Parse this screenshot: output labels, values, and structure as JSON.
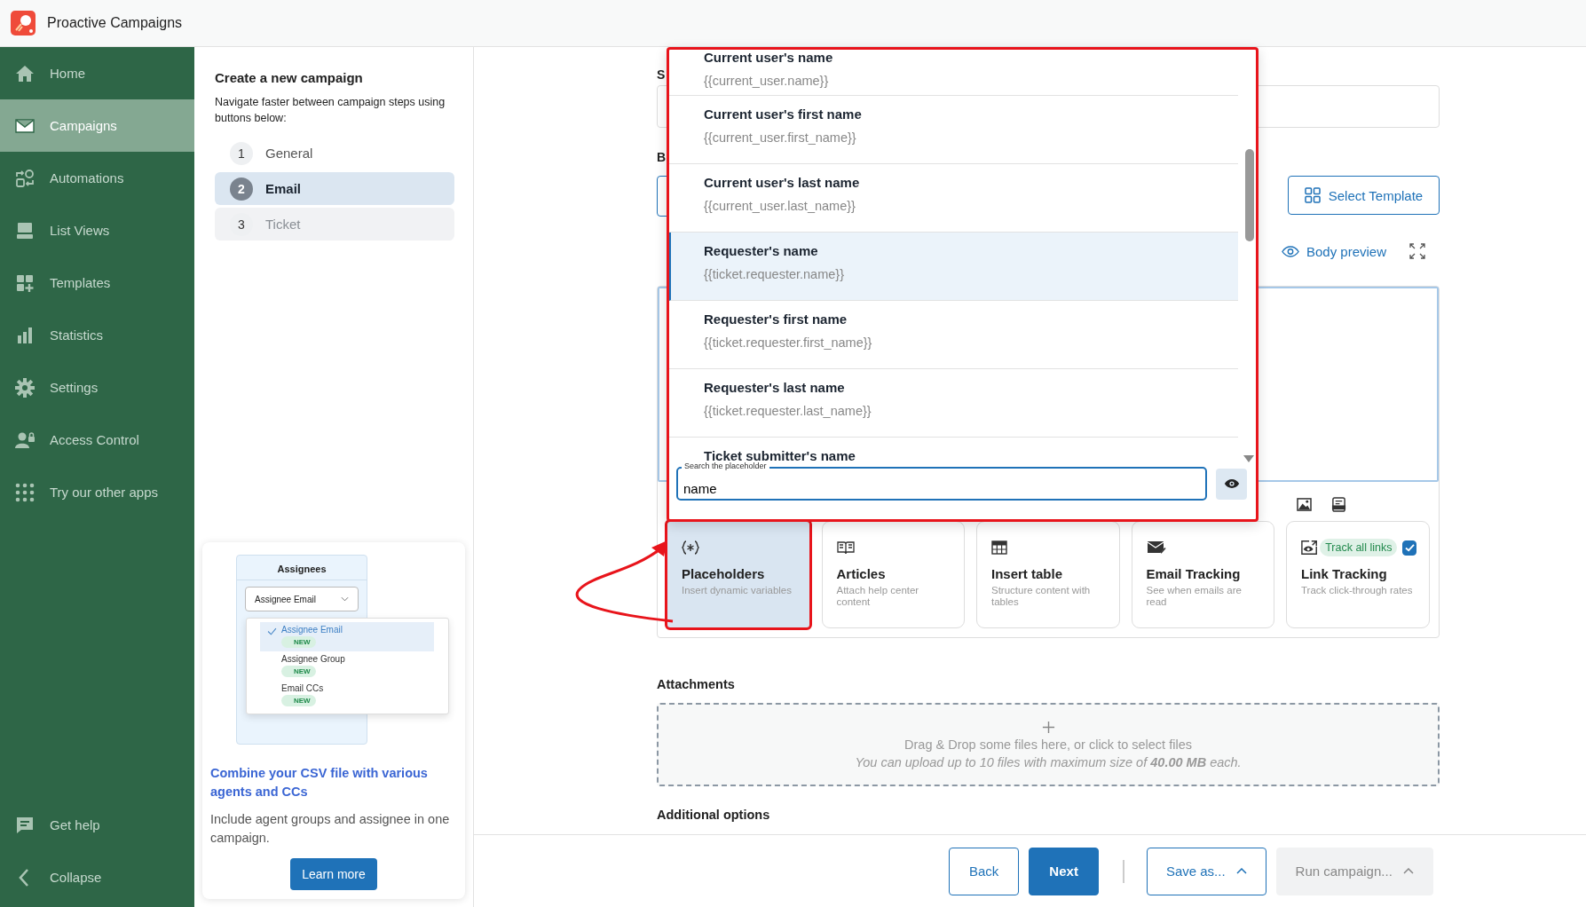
{
  "app": {
    "title": "Proactive Campaigns"
  },
  "sidebar": {
    "items": [
      {
        "label": "Home",
        "selected": false
      },
      {
        "label": "Campaigns",
        "selected": true
      },
      {
        "label": "Automations",
        "selected": false
      },
      {
        "label": "List Views",
        "selected": false
      },
      {
        "label": "Templates",
        "selected": false
      },
      {
        "label": "Statistics",
        "selected": false
      },
      {
        "label": "Settings",
        "selected": false
      },
      {
        "label": "Access Control",
        "selected": false
      },
      {
        "label": "Try our other apps",
        "selected": false
      }
    ],
    "footer_items": [
      {
        "label": "Get help"
      },
      {
        "label": "Collapse"
      }
    ]
  },
  "steps_panel": {
    "title": "Create a new campaign",
    "description": "Navigate faster between campaign steps using buttons below:",
    "steps": [
      {
        "number": "1",
        "label": "General",
        "selected": false,
        "disabled": false
      },
      {
        "number": "2",
        "label": "Email",
        "selected": true,
        "disabled": false
      },
      {
        "number": "3",
        "label": "Ticket",
        "selected": false,
        "disabled": true
      }
    ]
  },
  "promo": {
    "illustration": {
      "heading": "Assignees",
      "select_value": "Assignee Email",
      "options": [
        {
          "label": "Assignee Email",
          "badge": "NEW",
          "selected": true
        },
        {
          "label": "Assignee Group",
          "badge": "NEW",
          "selected": false
        },
        {
          "label": "Email CCs",
          "badge": "NEW",
          "selected": false
        }
      ]
    },
    "title": "Combine your CSV file with various agents and CCs",
    "text": "Include agent groups and assignee in one campaign.",
    "button": "Learn more"
  },
  "form": {
    "subject_label": "S",
    "body_label": "B",
    "select_template_button": "Select Template",
    "body_preview": "Body preview",
    "tools": [
      {
        "title": "Placeholders",
        "description": "Insert dynamic variables",
        "selected": true
      },
      {
        "title": "Articles",
        "description": "Attach help center content",
        "selected": false
      },
      {
        "title": "Insert table",
        "description": "Structure content with tables",
        "selected": false
      },
      {
        "title": "Email Tracking",
        "description": "See when emails are read",
        "selected": false
      },
      {
        "title": "Link Tracking",
        "description": "Track click-through rates",
        "selected": false,
        "badge": "Track all links",
        "checked": true
      }
    ],
    "attachments": {
      "label": "Attachments",
      "dropzone_text": "Drag & Drop some files here, or click to select files",
      "dropzone_hint": "You can upload up to 10 files with maximum size of **40.00 MB** each."
    },
    "additional_options_label": "Additional options"
  },
  "placeholder_menu": {
    "items": [
      {
        "title": "Current user's name",
        "code": "{{current_user.name}}",
        "selected": false
      },
      {
        "title": "Current user's first name",
        "code": "{{current_user.first_name}}",
        "selected": false
      },
      {
        "title": "Current user's last name",
        "code": "{{current_user.last_name}}",
        "selected": false
      },
      {
        "title": "Requester's name",
        "code": "{{ticket.requester.name}}",
        "selected": true
      },
      {
        "title": "Requester's first name",
        "code": "{{ticket.requester.first_name}}",
        "selected": false
      },
      {
        "title": "Requester's last name",
        "code": "{{ticket.requester.last_name}}",
        "selected": false
      },
      {
        "title": "Ticket submitter's name",
        "selected": false
      }
    ],
    "search": {
      "label": "Search the placeholder",
      "value": "name"
    }
  },
  "footer": {
    "buttons": [
      {
        "label": "Back",
        "kind": "outline",
        "disabled": false
      },
      {
        "label": "Next",
        "kind": "primary",
        "disabled": false
      },
      {
        "label": "Save as...",
        "kind": "dropdown",
        "disabled": false
      },
      {
        "label": "Run campaign...",
        "kind": "dropdown",
        "disabled": true
      }
    ]
  }
}
